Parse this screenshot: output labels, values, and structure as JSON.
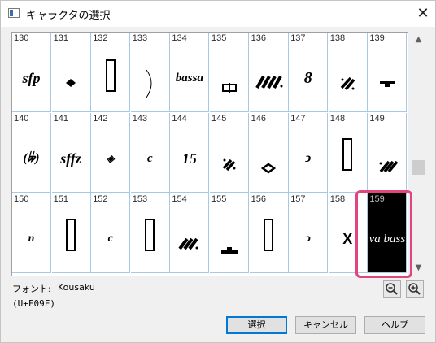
{
  "window": {
    "title": "キャラクタの選択",
    "close_glyph": "✕"
  },
  "cells": [
    {
      "num": "130"
    },
    {
      "num": "131"
    },
    {
      "num": "132"
    },
    {
      "num": "133"
    },
    {
      "num": "134",
      "text": "bassa"
    },
    {
      "num": "135"
    },
    {
      "num": "136"
    },
    {
      "num": "137",
      "text": "8"
    },
    {
      "num": "138"
    },
    {
      "num": "139"
    },
    {
      "num": "140",
      "text": "(𝄫)"
    },
    {
      "num": "141",
      "text": "sffz"
    },
    {
      "num": "142",
      "text": "◈"
    },
    {
      "num": "143",
      "text": "c"
    },
    {
      "num": "144",
      "text": "15"
    },
    {
      "num": "145"
    },
    {
      "num": "146"
    },
    {
      "num": "147",
      "text": "ↄ"
    },
    {
      "num": "148"
    },
    {
      "num": "149"
    },
    {
      "num": "150",
      "text": "n"
    },
    {
      "num": "151"
    },
    {
      "num": "152",
      "text": "c"
    },
    {
      "num": "153"
    },
    {
      "num": "154"
    },
    {
      "num": "155"
    },
    {
      "num": "156"
    },
    {
      "num": "157",
      "text": "ↄ"
    },
    {
      "num": "158",
      "text": "X"
    },
    {
      "num": "159",
      "text": "va bass"
    }
  ],
  "cell0_text": "sfp",
  "selected_index": 29,
  "scrollbar": {
    "up_glyph": "▲",
    "down_glyph": "▼",
    "position_fraction": 0.55
  },
  "font": {
    "label": "フォント:",
    "name": "Kousaku"
  },
  "code": "(U+F09F)",
  "buttons": {
    "select": "選択",
    "cancel": "キャンセル",
    "help": "ヘルプ"
  },
  "colors": {
    "highlight": "#e0457b",
    "grid_line": "#a9c8e6",
    "primary_border": "#0078d7"
  }
}
